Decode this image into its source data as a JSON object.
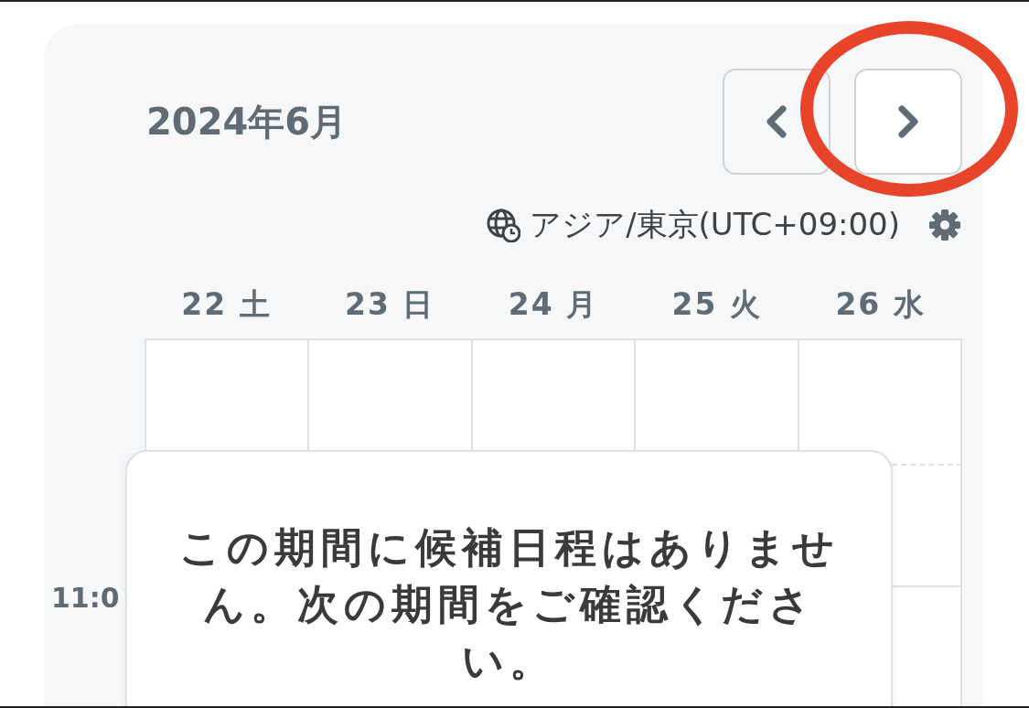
{
  "header": {
    "title": "2024年6月",
    "nav_buttons": [
      {
        "kind": "prev",
        "highlighted": false
      },
      {
        "kind": "next",
        "highlighted": true
      }
    ]
  },
  "timezone": {
    "label": "アジア/東京(UTC+09:00)"
  },
  "days": [
    {
      "date": "22",
      "weekday": "土"
    },
    {
      "date": "23",
      "weekday": "日"
    },
    {
      "date": "24",
      "weekday": "月"
    },
    {
      "date": "25",
      "weekday": "火"
    },
    {
      "date": "26",
      "weekday": "水"
    }
  ],
  "time_labels": [
    "11:0"
  ],
  "empty_notice": {
    "message": "この期間に候補日程はありません。次の期間をご確認ください。"
  }
}
